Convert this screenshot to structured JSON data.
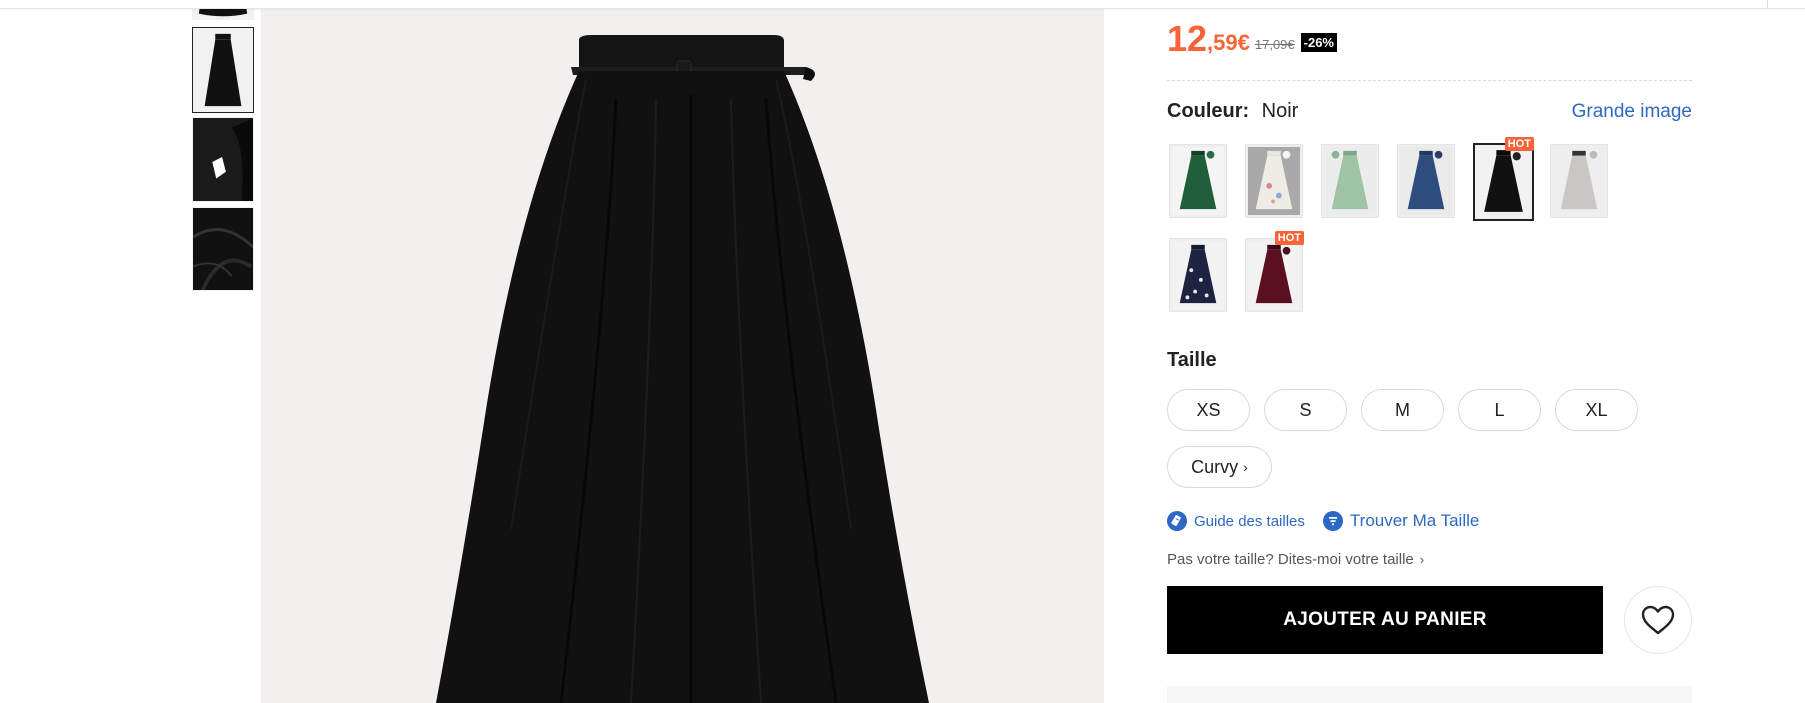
{
  "price": {
    "integer": "12",
    "decimal": ",59€",
    "original": "17,09€",
    "discount": "-26%",
    "color": "#fa6338"
  },
  "color_section": {
    "label": "Couleur:",
    "value": "Noir",
    "big_image_link": "Grande image",
    "swatches": [
      {
        "name": "green",
        "color": "#1f5f3a",
        "hot": ""
      },
      {
        "name": "floral-white",
        "color": "#ece8e4",
        "hot": ""
      },
      {
        "name": "sage-green",
        "color": "#9fc3a5",
        "hot": ""
      },
      {
        "name": "denim-blue",
        "color": "#2c4d7e",
        "hot": ""
      },
      {
        "name": "black",
        "color": "#111111",
        "hot": "HOT",
        "selected": true
      },
      {
        "name": "light-grey",
        "color": "#c9c6c3",
        "hot": ""
      },
      {
        "name": "navy-floral",
        "color": "#1d2340",
        "hot": ""
      },
      {
        "name": "burgundy",
        "color": "#5b1020",
        "hot": "HOT"
      }
    ]
  },
  "size_section": {
    "title": "Taille",
    "sizes": [
      "XS",
      "S",
      "M",
      "L",
      "XL"
    ],
    "curvy": "Curvy",
    "guide_label": "Guide des tailles",
    "find_label": "Trouver Ma Taille",
    "ask_label": "Pas votre taille? Dites-moi votre taille"
  },
  "actions": {
    "add_to_cart": "AJOUTER AU PANIER",
    "wishlist_icon": "heart-icon"
  },
  "colors": {
    "accent": "#fa6338",
    "link": "#2d68c4",
    "button": "#000000"
  }
}
